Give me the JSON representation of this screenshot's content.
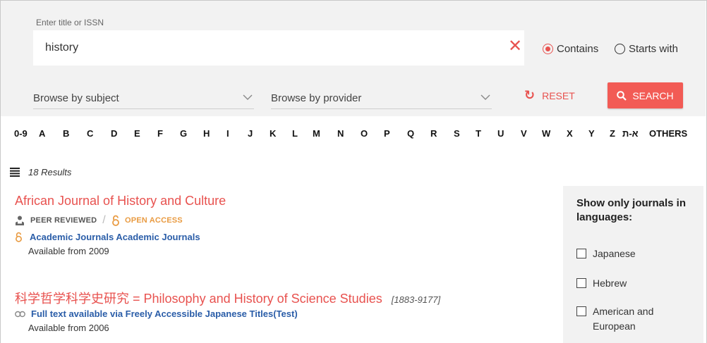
{
  "search": {
    "label": "Enter title or ISSN",
    "value": "history",
    "clear": "✕",
    "options": [
      {
        "label": "Contains",
        "selected": true
      },
      {
        "label": "Starts with",
        "selected": false
      }
    ]
  },
  "filters": {
    "subject_label": "Browse by subject",
    "provider_label": "Browse by provider",
    "reset_label": "RESET",
    "search_label": "SEARCH"
  },
  "letters": [
    "0-9",
    "A",
    "B",
    "C",
    "D",
    "E",
    "F",
    "G",
    "H",
    "I",
    "J",
    "K",
    "L",
    "M",
    "N",
    "O",
    "P",
    "Q",
    "R",
    "S",
    "T",
    "U",
    "V",
    "W",
    "X",
    "Y",
    "Z",
    "א-ת",
    "OTHERS"
  ],
  "results": {
    "count": "18 Results",
    "items": [
      {
        "title": "African Journal of History and Culture",
        "peer_reviewed": "PEER REVIEWED",
        "separator": "/",
        "open_access": "OPEN ACCESS",
        "provider": "Academic Journals Academic Journals",
        "available": "Available from 2009"
      },
      {
        "title": "科学哲学科学史研究 = Philosophy and History of Science Studies",
        "issn": "[1883-9177]",
        "provider": "Full text available via Freely Accessible Japanese Titles(Test)",
        "available": "Available from 2006"
      }
    ]
  },
  "language_filter": {
    "title": "Show only journals in languages:",
    "options": [
      "Japanese",
      "Hebrew",
      "American and European"
    ]
  },
  "colors": {
    "accent": "#e8524f",
    "link": "#2a5da8",
    "open_access": "#e99b42"
  }
}
